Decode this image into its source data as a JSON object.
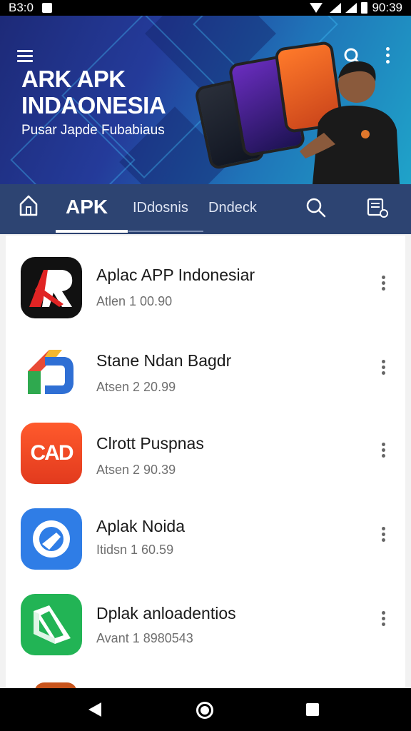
{
  "status_bar": {
    "time_left": "B3:0",
    "time_right": "90:39"
  },
  "hero": {
    "title_line1": "ARK APK",
    "title_line2": "INDAONESIA",
    "subtitle": "Pusar Japde Fubabiaus"
  },
  "tabs": {
    "active": "APK",
    "tab2": "IDdosnis",
    "tab3": "Dndeck"
  },
  "apps": [
    {
      "name": "Aplac APP Indonesiar",
      "version": "Atlen 1 00.90",
      "icon": "ar-logo-icon",
      "color": "#111111"
    },
    {
      "name": "Stane Ndan Bagdr",
      "version": "Atsen 2 20.99",
      "icon": "colorful-d-icon",
      "color": "#ffffff"
    },
    {
      "name": "Clrott Puspnas",
      "version": "Atsen 2 90.39",
      "icon": "cad-logo-icon",
      "color": "#f0442a"
    },
    {
      "name": "Aplak Noida",
      "version": "Itidsn 1 60.59",
      "icon": "blue-q-icon",
      "color": "#2f7de6"
    },
    {
      "name": "Dplak anloadentios",
      "version": "Avant 1 8980543",
      "icon": "green-book-icon",
      "color": "#22b455"
    }
  ],
  "colors": {
    "tab_bar": "#2d4472",
    "hero_start": "#1d2a78",
    "hero_end": "#1fa3c9"
  }
}
